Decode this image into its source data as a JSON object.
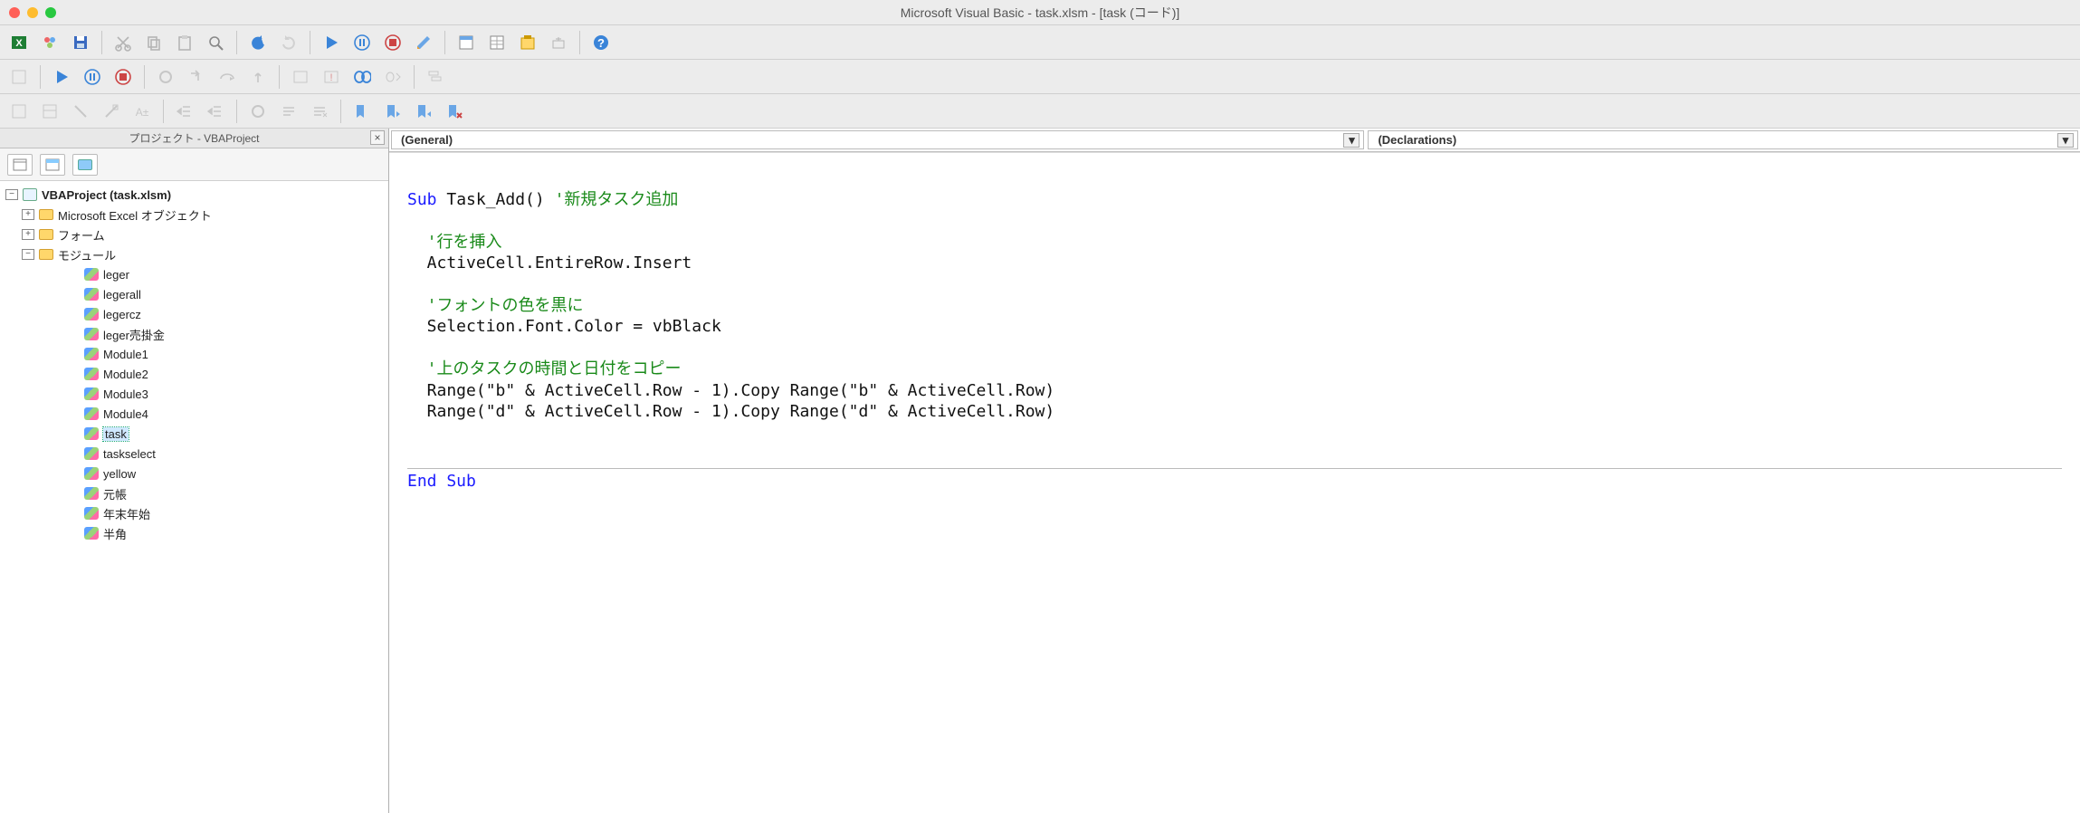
{
  "window": {
    "title": "Microsoft Visual Basic - task.xlsm - [task (コード)]"
  },
  "panel": {
    "title": "プロジェクト - VBAProject",
    "root": "VBAProject (task.xlsm)",
    "folders": {
      "excelObjects": "Microsoft Excel オブジェクト",
      "forms": "フォーム",
      "modules": "モジュール"
    },
    "modules": [
      "leger",
      "legerall",
      "legercz",
      "leger売掛金",
      "Module1",
      "Module2",
      "Module3",
      "Module4",
      "task",
      "taskselect",
      "yellow",
      "元帳",
      "年末年始",
      "半角"
    ],
    "selected": "task"
  },
  "dropdowns": {
    "left": "(General)",
    "right": "(Declarations)"
  },
  "code": {
    "l1a": "Sub",
    "l1b": " Task_Add() ",
    "l1c": "'新規タスク追加",
    "l2": "'行を挿入",
    "l3": "ActiveCell.EntireRow.Insert",
    "l4": "'フォントの色を黒に",
    "l5": "Selection.Font.Color = vbBlack",
    "l6": "'上のタスクの時間と日付をコピー",
    "l7": "Range(\"b\" & ActiveCell.Row - 1).Copy Range(\"b\" & ActiveCell.Row)",
    "l8": "Range(\"d\" & ActiveCell.Row - 1).Copy Range(\"d\" & ActiveCell.Row)",
    "l9": "End Sub"
  }
}
